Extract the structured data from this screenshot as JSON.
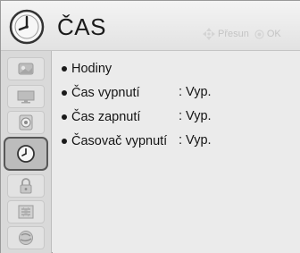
{
  "header": {
    "title": "ČAS",
    "icon": "clock-icon",
    "hint_move_label": "Přesun",
    "hint_ok_label": "OK"
  },
  "sidebar": {
    "items": [
      {
        "icon": "picture-icon",
        "active": false
      },
      {
        "icon": "screen-icon",
        "active": false
      },
      {
        "icon": "sound-icon",
        "active": false
      },
      {
        "icon": "clock-icon",
        "active": true
      },
      {
        "icon": "lock-icon",
        "active": false
      },
      {
        "icon": "options-icon",
        "active": false
      },
      {
        "icon": "network-icon",
        "active": false
      }
    ]
  },
  "menu": {
    "items": [
      {
        "label": "Hodiny",
        "value": ""
      },
      {
        "label": "Čas vypnutí",
        "value": ": Vyp."
      },
      {
        "label": "Čas zapnutí",
        "value": ": Vyp."
      },
      {
        "label": "Časovač vypnutí",
        "value": ": Vyp."
      }
    ]
  },
  "colors": {
    "panel_bg": "#ebebeb",
    "sidebar_bg": "#d9d9d9",
    "active_border": "#585858",
    "hint_text": "#c4c4c4"
  }
}
